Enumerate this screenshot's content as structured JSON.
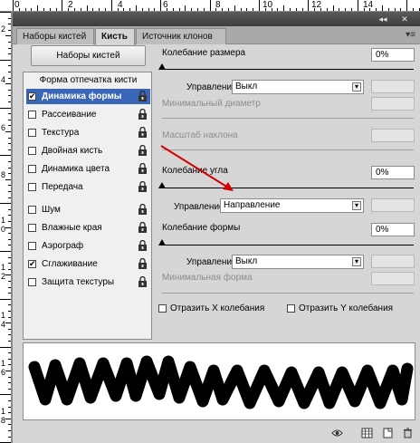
{
  "ruler": {
    "top_numbers": [
      "0",
      "2",
      "4",
      "6",
      "8",
      "10",
      "12",
      "14"
    ],
    "left_numbers": [
      "2",
      "4",
      "6",
      "8",
      "1\n0",
      "1\n2",
      "1\n4",
      "1\n6",
      "1\n8"
    ]
  },
  "window": {
    "close_glyph": "✕",
    "collapse_glyph": "◂◂"
  },
  "tabs": [
    {
      "label": "Наборы кистей"
    },
    {
      "label": "Кисть"
    },
    {
      "label": "Источник клонов"
    }
  ],
  "tab_menu_glyph": "▾≡",
  "presets_button": "Наборы кистей",
  "list": {
    "header": "Форма отпечатка кисти",
    "items": [
      {
        "label": "Динамика формы",
        "checked": "✔",
        "selected": true
      },
      {
        "label": "Рассеивание",
        "checked": ""
      },
      {
        "label": "Текстура",
        "checked": ""
      },
      {
        "label": "Двойная кисть",
        "checked": ""
      },
      {
        "label": "Динамика цвета",
        "checked": ""
      },
      {
        "label": "Передача",
        "checked": ""
      },
      {
        "label": "Шум",
        "checked": ""
      },
      {
        "label": "Влажные края",
        "checked": ""
      },
      {
        "label": "Аэрограф",
        "checked": ""
      },
      {
        "label": "Сглаживание",
        "checked": "✔"
      },
      {
        "label": "Защита текстуры",
        "checked": ""
      }
    ]
  },
  "settings": {
    "size_jitter": {
      "label": "Колебание размера",
      "value": "0%"
    },
    "control1": {
      "label": "Управление:",
      "value": "Выкл"
    },
    "min_diameter": {
      "label": "Минимальный диаметр"
    },
    "tilt_scale": {
      "label": "Масштаб наклона"
    },
    "angle_jitter": {
      "label": "Колебание угла",
      "value": "0%"
    },
    "control2": {
      "label": "Управление:",
      "value": "Направление"
    },
    "roundness_jitter": {
      "label": "Колебание формы",
      "value": "0%"
    },
    "control3": {
      "label": "Управление:",
      "value": "Выкл"
    },
    "min_roundness": {
      "label": "Минимальная форма"
    },
    "flip_x": {
      "label": "Отразить X колебания"
    },
    "flip_y": {
      "label": "Отразить Y колебания"
    }
  },
  "colors": {
    "selection": "#3a66b8",
    "annotation_arrow": "#d40000",
    "panel": "#d6d6d6"
  },
  "bottom_icons": [
    "eye-icon",
    "grid-icon",
    "new-preset-icon",
    "trash-icon"
  ]
}
